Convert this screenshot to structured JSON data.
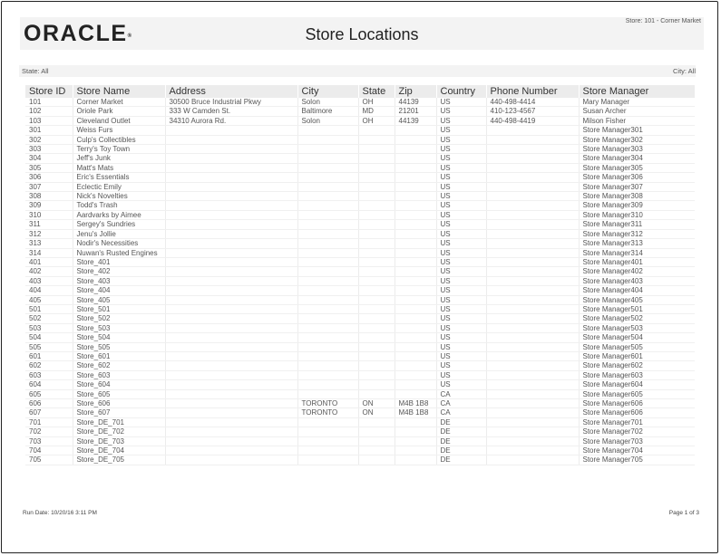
{
  "header": {
    "logo_text": "ORACLE",
    "logo_mark": "®",
    "title": "Store Locations",
    "store_context": "Store: 101 - Corner Market"
  },
  "filters": {
    "state": "State: All",
    "city": "City: All"
  },
  "table": {
    "columns": [
      "Store ID",
      "Store Name",
      "Address",
      "City",
      "State",
      "Zip",
      "Country",
      "Phone Number",
      "Store Manager"
    ],
    "rows": [
      [
        "101",
        "Corner Market",
        "30500 Bruce Industrial Pkwy",
        "Solon",
        "OH",
        "44139",
        "US",
        "440-498-4414",
        "Mary Manager"
      ],
      [
        "102",
        "Oriole Park",
        "333 W Camden St.",
        "Baltimore",
        "MD",
        "21201",
        "US",
        "410-123-4567",
        "Susan Archer"
      ],
      [
        "103",
        "Cleveland Outlet",
        "34310 Aurora Rd.",
        "Solon",
        "OH",
        "44139",
        "US",
        "440-498-4419",
        "Milson Fisher"
      ],
      [
        "301",
        "Weiss Furs",
        "",
        "",
        "",
        "",
        "US",
        "",
        "Store Manager301"
      ],
      [
        "302",
        "Culp's Collectibles",
        "",
        "",
        "",
        "",
        "US",
        "",
        "Store Manager302"
      ],
      [
        "303",
        "Terry's Toy Town",
        "",
        "",
        "",
        "",
        "US",
        "",
        "Store Manager303"
      ],
      [
        "304",
        "Jeff's Junk",
        "",
        "",
        "",
        "",
        "US",
        "",
        "Store Manager304"
      ],
      [
        "305",
        "Matt's Mats",
        "",
        "",
        "",
        "",
        "US",
        "",
        "Store Manager305"
      ],
      [
        "306",
        "Eric's Essentials",
        "",
        "",
        "",
        "",
        "US",
        "",
        "Store Manager306"
      ],
      [
        "307",
        "Eclectic Emily",
        "",
        "",
        "",
        "",
        "US",
        "",
        "Store Manager307"
      ],
      [
        "308",
        "Nick's Novelties",
        "",
        "",
        "",
        "",
        "US",
        "",
        "Store Manager308"
      ],
      [
        "309",
        "Todd's Trash",
        "",
        "",
        "",
        "",
        "US",
        "",
        "Store Manager309"
      ],
      [
        "310",
        "Aardvarks by Aimee",
        "",
        "",
        "",
        "",
        "US",
        "",
        "Store Manager310"
      ],
      [
        "311",
        "Sergey's Sundries",
        "",
        "",
        "",
        "",
        "US",
        "",
        "Store Manager311"
      ],
      [
        "312",
        "Jenu's Jollie",
        "",
        "",
        "",
        "",
        "US",
        "",
        "Store Manager312"
      ],
      [
        "313",
        "Nodir's Necessities",
        "",
        "",
        "",
        "",
        "US",
        "",
        "Store Manager313"
      ],
      [
        "314",
        "Nuwan's Rusted Engines",
        "",
        "",
        "",
        "",
        "US",
        "",
        "Store Manager314"
      ],
      [
        "401",
        "Store_401",
        "",
        "",
        "",
        "",
        "US",
        "",
        "Store Manager401"
      ],
      [
        "402",
        "Store_402",
        "",
        "",
        "",
        "",
        "US",
        "",
        "Store Manager402"
      ],
      [
        "403",
        "Store_403",
        "",
        "",
        "",
        "",
        "US",
        "",
        "Store Manager403"
      ],
      [
        "404",
        "Store_404",
        "",
        "",
        "",
        "",
        "US",
        "",
        "Store Manager404"
      ],
      [
        "405",
        "Store_405",
        "",
        "",
        "",
        "",
        "US",
        "",
        "Store Manager405"
      ],
      [
        "501",
        "Store_501",
        "",
        "",
        "",
        "",
        "US",
        "",
        "Store Manager501"
      ],
      [
        "502",
        "Store_502",
        "",
        "",
        "",
        "",
        "US",
        "",
        "Store Manager502"
      ],
      [
        "503",
        "Store_503",
        "",
        "",
        "",
        "",
        "US",
        "",
        "Store Manager503"
      ],
      [
        "504",
        "Store_504",
        "",
        "",
        "",
        "",
        "US",
        "",
        "Store Manager504"
      ],
      [
        "505",
        "Store_505",
        "",
        "",
        "",
        "",
        "US",
        "",
        "Store Manager505"
      ],
      [
        "601",
        "Store_601",
        "",
        "",
        "",
        "",
        "US",
        "",
        "Store Manager601"
      ],
      [
        "602",
        "Store_602",
        "",
        "",
        "",
        "",
        "US",
        "",
        "Store Manager602"
      ],
      [
        "603",
        "Store_603",
        "",
        "",
        "",
        "",
        "US",
        "",
        "Store Manager603"
      ],
      [
        "604",
        "Store_604",
        "",
        "",
        "",
        "",
        "US",
        "",
        "Store Manager604"
      ],
      [
        "605",
        "Store_605",
        "",
        "",
        "",
        "",
        "CA",
        "",
        "Store Manager605"
      ],
      [
        "606",
        "Store_606",
        "",
        "TORONTO",
        "ON",
        "M4B 1B8",
        "CA",
        "",
        "Store Manager606"
      ],
      [
        "607",
        "Store_607",
        "",
        "TORONTO",
        "ON",
        "M4B 1B8",
        "CA",
        "",
        "Store Manager606"
      ],
      [
        "701",
        "Store_DE_701",
        "",
        "",
        "",
        "",
        "DE",
        "",
        "Store Manager701"
      ],
      [
        "702",
        "Store_DE_702",
        "",
        "",
        "",
        "",
        "DE",
        "",
        "Store Manager702"
      ],
      [
        "703",
        "Store_DE_703",
        "",
        "",
        "",
        "",
        "DE",
        "",
        "Store Manager703"
      ],
      [
        "704",
        "Store_DE_704",
        "",
        "",
        "",
        "",
        "DE",
        "",
        "Store Manager704"
      ],
      [
        "705",
        "Store_DE_705",
        "",
        "",
        "",
        "",
        "DE",
        "",
        "Store Manager705"
      ]
    ]
  },
  "footer": {
    "run_date": "Run Date: 10/20/16 3:11 PM",
    "page": "Page 1 of 3"
  }
}
